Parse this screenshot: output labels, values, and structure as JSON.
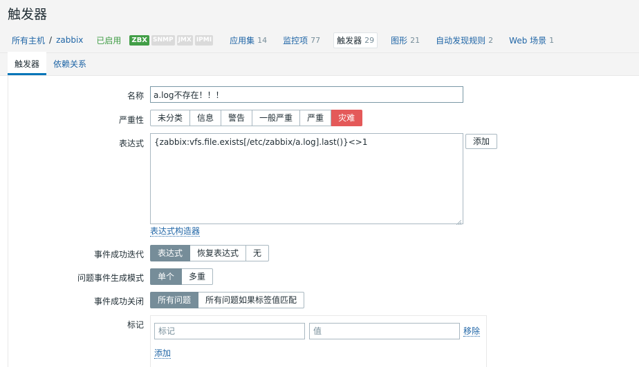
{
  "page": {
    "title": "触发器"
  },
  "host_nav": {
    "all_hosts": "所有主机",
    "separator": "/",
    "host": "zabbix",
    "status": "已启用",
    "availability": [
      "ZBX",
      "SNMP",
      "JMX",
      "IPMI"
    ],
    "items": [
      {
        "label": "应用集",
        "count": "14"
      },
      {
        "label": "监控项",
        "count": "77"
      },
      {
        "label": "触发器",
        "count": "29"
      },
      {
        "label": "图形",
        "count": "21"
      },
      {
        "label": "自动发现规则",
        "count": "2"
      },
      {
        "label": "Web 场景",
        "count": "1"
      }
    ]
  },
  "tabs": [
    "触发器",
    "依赖关系"
  ],
  "form": {
    "name_label": "名称",
    "name_value": "a.log不存在！！！",
    "severity_label": "严重性",
    "severities": [
      "未分类",
      "信息",
      "警告",
      "一般严重",
      "严重",
      "灾难"
    ],
    "severity_selected": "灾难",
    "expression_label": "表达式",
    "expression_value": "{zabbix:vfs.file.exists[/etc/zabbix/a.log].last()}<>1",
    "add_button": "添加",
    "expression_builder": "表达式构造器",
    "ok_event_label": "事件成功迭代",
    "ok_event_options": [
      "表达式",
      "恢复表达式",
      "无"
    ],
    "ok_event_selected": "表达式",
    "problem_mode_label": "问题事件生成模式",
    "problem_mode_options": [
      "单个",
      "多重"
    ],
    "problem_mode_selected": "单个",
    "ok_close_label": "事件成功关闭",
    "ok_close_options": [
      "所有问题",
      "所有问题如果标签值匹配"
    ],
    "ok_close_selected": "所有问题",
    "tags_label": "标记",
    "tag_placeholder": "标记",
    "value_placeholder": "值",
    "remove_link": "移除",
    "add_link": "添加"
  },
  "colors": {
    "link": "#1f65a6",
    "enabled": "#429e47",
    "disaster": "#e45959",
    "selected": "#768d99"
  }
}
